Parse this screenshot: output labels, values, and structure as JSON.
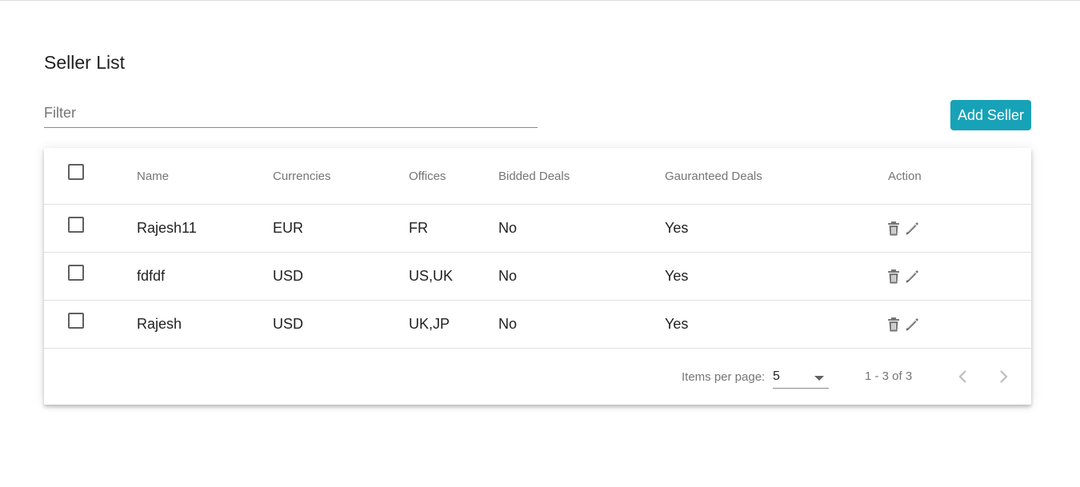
{
  "page": {
    "title": "Seller List"
  },
  "filter": {
    "placeholder": "Filter",
    "value": ""
  },
  "toolbar": {
    "add_label": "Add Seller"
  },
  "table": {
    "headers": {
      "name": "Name",
      "currencies": "Currencies",
      "offices": "Offices",
      "bidded": "Bidded Deals",
      "guaranteed": "Gauranteed Deals",
      "action": "Action"
    },
    "rows": [
      {
        "name": "Rajesh11",
        "currencies": "EUR",
        "offices": "FR",
        "bidded": "No",
        "guaranteed": "Yes"
      },
      {
        "name": "fdfdf",
        "currencies": "USD",
        "offices": "US,UK",
        "bidded": "No",
        "guaranteed": "Yes"
      },
      {
        "name": "Rajesh",
        "currencies": "USD",
        "offices": "UK,JP",
        "bidded": "No",
        "guaranteed": "Yes"
      }
    ],
    "row_icons": [
      "trash-icon",
      "pencil-icon"
    ]
  },
  "paginator": {
    "items_per_page_label": "Items per page:",
    "items_per_page_value": "5",
    "range_label": "1 - 3 of 3"
  },
  "colors": {
    "accent": "#17a2b8",
    "icon": "#757575"
  }
}
